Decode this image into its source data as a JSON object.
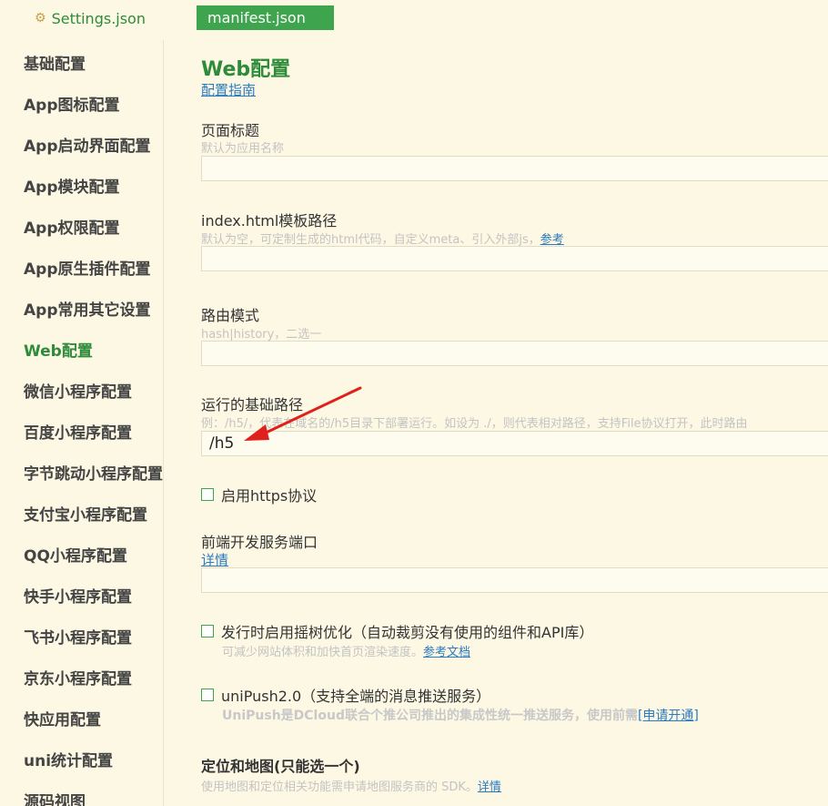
{
  "tabs": {
    "settings_label": "Settings.json",
    "manifest_label": "manifest.json"
  },
  "sidebar": {
    "items": [
      {
        "label": "基础配置"
      },
      {
        "label": "App图标配置"
      },
      {
        "label": "App启动界面配置"
      },
      {
        "label": "App模块配置"
      },
      {
        "label": "App权限配置"
      },
      {
        "label": "App原生插件配置"
      },
      {
        "label": "App常用其它设置"
      },
      {
        "label": "Web配置"
      },
      {
        "label": "微信小程序配置"
      },
      {
        "label": "百度小程序配置"
      },
      {
        "label": "字节跳动小程序配置"
      },
      {
        "label": "支付宝小程序配置"
      },
      {
        "label": "QQ小程序配置"
      },
      {
        "label": "快手小程序配置"
      },
      {
        "label": "飞书小程序配置"
      },
      {
        "label": "京东小程序配置"
      },
      {
        "label": "快应用配置"
      },
      {
        "label": "uni统计配置"
      },
      {
        "label": "源码视图"
      }
    ],
    "active_index": 7
  },
  "main": {
    "title": "Web配置",
    "guide_link": "配置指南",
    "page_title": {
      "label": "页面标题",
      "hint": "默认为应用名称",
      "value": ""
    },
    "index_template": {
      "label": "index.html模板路径",
      "hint": "默认为空，可定制生成的html代码，自定义meta、引入外部js，",
      "hint_link": "参考",
      "value": ""
    },
    "router_mode": {
      "label": "路由模式",
      "hint": "hash|history，二选一",
      "value": ""
    },
    "base_path": {
      "label": "运行的基础路径",
      "hint": "例：/h5/，代表在域名的/h5目录下部署运行。如设为 ./，则代表相对路径，支持File协议打开，此时路由",
      "value": "/h5"
    },
    "https": {
      "label": "启用https协议",
      "checked": false
    },
    "dev_port": {
      "label": "前端开发服务端口",
      "link": "详情",
      "value": ""
    },
    "tree_shaking": {
      "label": "发行时启用摇树优化（自动裁剪没有使用的组件和API库）",
      "hint": "可减少网站体积和加快首页渲染速度。",
      "hint_link": "参考文档",
      "checked": false
    },
    "unipush": {
      "label": "uniPush2.0（支持全端的消息推送服务）",
      "hint": "UniPush是DCloud联合个推公司推出的集成性统一推送服务，使用前需",
      "hint_link": "[申请开通]",
      "checked": false
    },
    "location": {
      "title": "定位和地图(只能选一个)",
      "hint": "使用地图和定位相关功能需申请地图服务商的 SDK。",
      "hint_link": "详情"
    }
  },
  "colors": {
    "accent_green": "#2e8b3a",
    "tab_active_bg": "#3ea44e",
    "background": "#fdf8e4",
    "link_blue": "#2a7ac0",
    "arrow_red": "#e0201c"
  },
  "icons": {
    "settings_tab_icon": "gear-icon",
    "annotation": "red-arrow-icon"
  }
}
